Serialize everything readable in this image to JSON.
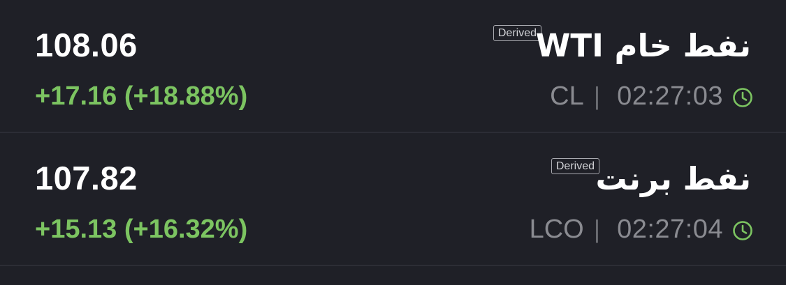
{
  "colors": {
    "background": "#1f2027",
    "divider": "#2c2d35",
    "positive": "#7cc461",
    "muted": "#8a8b91",
    "clock_icon": "#7cc461"
  },
  "icons": {
    "clock": "clock-icon"
  },
  "quotes": [
    {
      "name": "نفط خام WTI",
      "badge": "Derived",
      "price": "108.06",
      "change": "+17.16 (+18.88%)",
      "ticker": "CL",
      "separator": "|",
      "time": "02:27:03"
    },
    {
      "name": "نفط برنت",
      "badge": "Derived",
      "price": "107.82",
      "change": "+15.13 (+16.32%)",
      "ticker": "LCO",
      "separator": "|",
      "time": "02:27:04"
    }
  ]
}
